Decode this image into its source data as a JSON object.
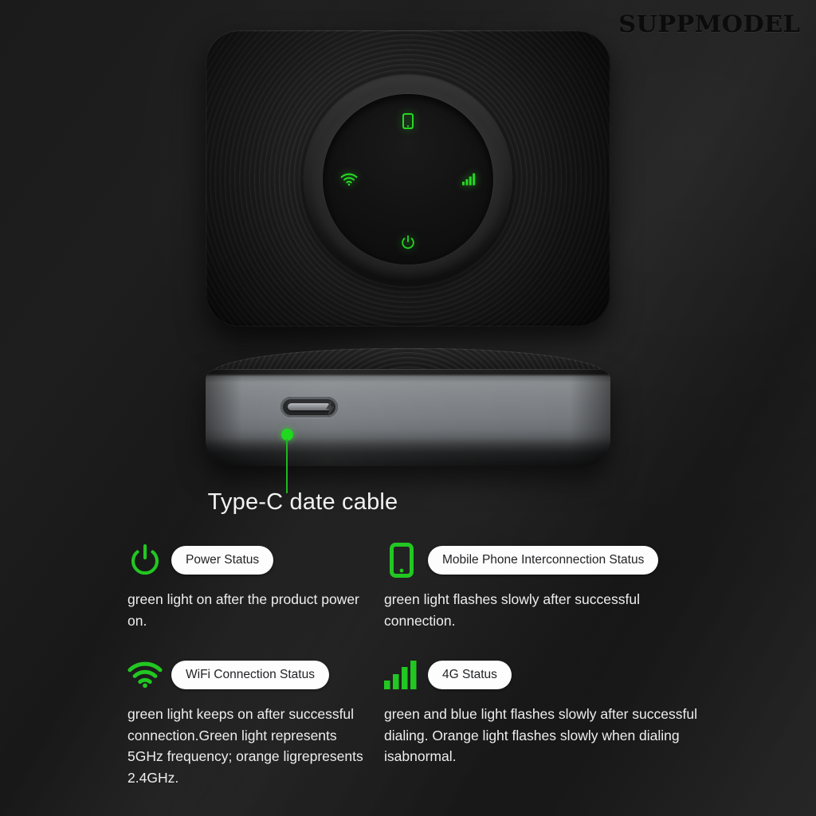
{
  "watermark": {
    "text": "SUPPMODEL"
  },
  "colors": {
    "background": "#1b1b1b",
    "led_green": "#27d723",
    "icon_green": "#22c722",
    "pill_background": "#fdfdfd",
    "pill_text": "#222326",
    "body_text": "#eeeeee",
    "metal_band": "#7e8185"
  },
  "product": {
    "top_view": {
      "name": "mobile-wifi-router-top-view",
      "dial_leds": [
        {
          "position": "top",
          "icon": "phone-icon",
          "state": "on",
          "color": "#27d723"
        },
        {
          "position": "left",
          "icon": "wifi-icon",
          "state": "on",
          "color": "#27d723"
        },
        {
          "position": "right",
          "icon": "signal-bars-icon",
          "state": "on",
          "color": "#27d723"
        },
        {
          "position": "bottom",
          "icon": "power-icon",
          "state": "on",
          "color": "#27d723"
        }
      ]
    },
    "side_view": {
      "name": "mobile-wifi-router-side-view",
      "port_icon": "usb-c-port-icon",
      "charge_icon": "lightning-bolt-icon"
    }
  },
  "callout": {
    "label": "Type-C date cable",
    "marker": "callout-dot"
  },
  "legend": {
    "items": [
      {
        "icon": "power-icon",
        "label": "Power Status",
        "description": "green light on after the product power on."
      },
      {
        "icon": "phone-icon",
        "label": "Mobile Phone Interconnection Status",
        "description": "green light flashes slowly after successful connection."
      },
      {
        "icon": "wifi-icon",
        "label": "WiFi Connection Status",
        "description": "green light keeps on after successful connection.Green light represents 5GHz frequency; orange ligrepresents 2.4GHz."
      },
      {
        "icon": "signal-bars-icon",
        "label": "4G Status",
        "description": "green and blue light flashes slowly after successful dialing. Orange light flashes slowly when dialing isabnormal."
      }
    ]
  }
}
